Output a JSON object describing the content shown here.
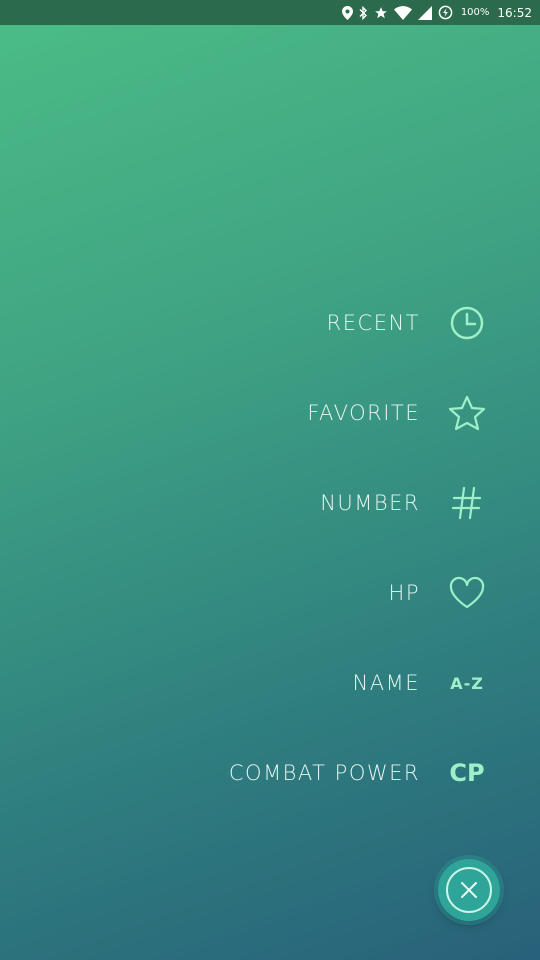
{
  "status_bar": {
    "battery_percent": "100%",
    "time": "16:52",
    "icons": [
      "location-icon",
      "bluetooth-icon",
      "star-icon",
      "wifi-icon",
      "signal-icon",
      "battery-saver-icon"
    ]
  },
  "sort_menu": {
    "items": [
      {
        "label": "RECENT",
        "icon": "clock-icon"
      },
      {
        "label": "FAVORITE",
        "icon": "star-outline-icon"
      },
      {
        "label": "NUMBER",
        "icon": "hash-icon"
      },
      {
        "label": "HP",
        "icon": "heart-icon"
      },
      {
        "label": "NAME",
        "icon": "az-icon",
        "icon_text": "A-Z"
      },
      {
        "label": "COMBAT POWER",
        "icon": "cp-icon",
        "icon_text": "CP"
      }
    ]
  },
  "close_button": {
    "icon": "close-icon"
  },
  "colors": {
    "gradient_top": "#4cbd86",
    "gradient_bottom": "#28617a",
    "icon_accent": "#9ef0c8",
    "fab": "#2fa59a"
  }
}
